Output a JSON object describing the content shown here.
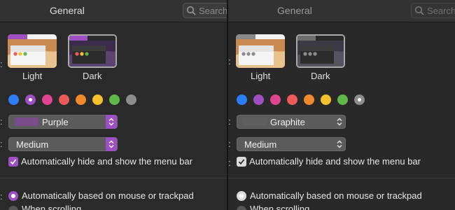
{
  "left_panel": {
    "title": "General",
    "search_placeholder": "Search",
    "appearance": {
      "light_label": "Light",
      "dark_label": "Dark"
    },
    "accent_colors": [
      "#2d7df6",
      "#9e4fc2",
      "#e0458f",
      "#ec5a5a",
      "#f08a2c",
      "#f5c12d",
      "#5fb848",
      "#8c8c8c"
    ],
    "selected_accent_index": 1,
    "highlight_color": {
      "label": "Purple",
      "swatch": "#7a4c8a"
    },
    "sidebar_icon_size": {
      "value": "Medium"
    },
    "menu_bar_checkbox": {
      "label": "Automatically hide and show the menu bar",
      "checked": true
    },
    "scroll_bars": {
      "options": [
        "Automatically based on mouse or trackpad",
        "When scrolling"
      ],
      "selected_index": 0
    },
    "control_accent": "#9e4fc2"
  },
  "right_panel": {
    "title": "General",
    "search_placeholder": "Search",
    "appearance": {
      "light_label": "Light",
      "dark_label": "Dark"
    },
    "accent_colors": [
      "#2d7df6",
      "#9e4fc2",
      "#e0458f",
      "#ec5a5a",
      "#f08a2c",
      "#f5c12d",
      "#5fb848",
      "#8c8c8c"
    ],
    "selected_accent_index": 7,
    "highlight_color": {
      "label": "Graphite",
      "swatch": "#5e5e5e"
    },
    "sidebar_icon_size": {
      "value": "Medium"
    },
    "menu_bar_checkbox": {
      "label": "Automatically hide and show the menu bar",
      "checked": true
    },
    "scroll_bars": {
      "options": [
        "Automatically based on mouse or trackpad",
        "When scrolling"
      ],
      "selected_index": 0
    },
    "control_accent": "#6e6e6e"
  }
}
